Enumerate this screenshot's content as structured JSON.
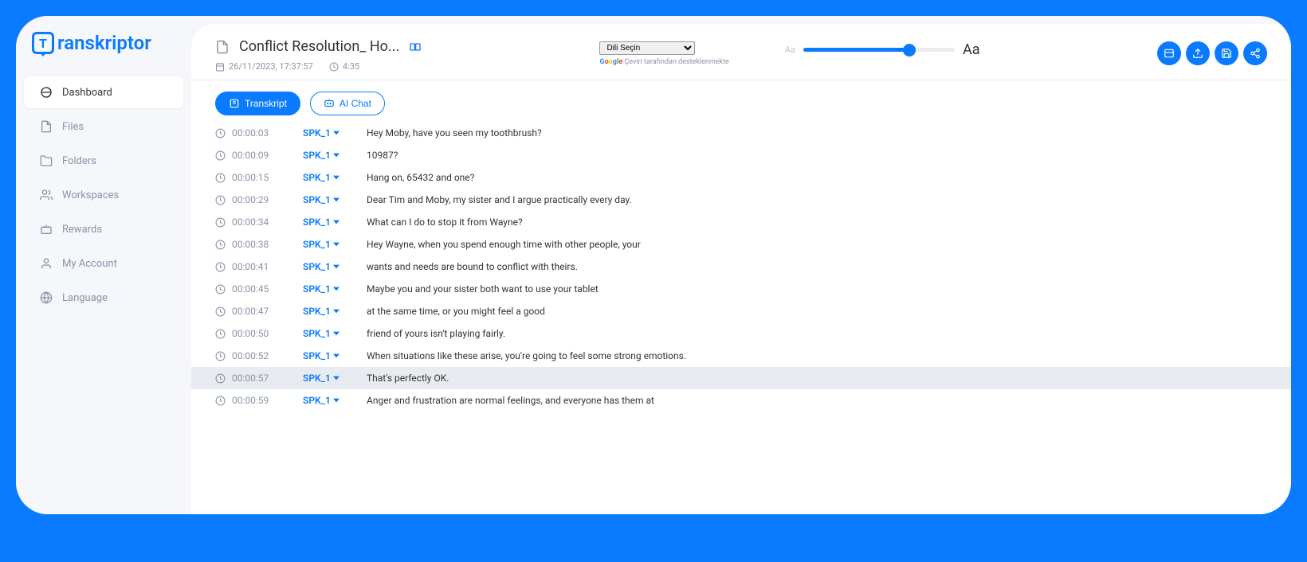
{
  "brand": "ranskriptor",
  "sidebar": {
    "items": [
      {
        "label": "Dashboard",
        "active": true
      },
      {
        "label": "Files",
        "active": false
      },
      {
        "label": "Folders",
        "active": false
      },
      {
        "label": "Workspaces",
        "active": false
      },
      {
        "label": "Rewards",
        "active": false
      },
      {
        "label": "My Account",
        "active": false
      },
      {
        "label": "Language",
        "active": false
      }
    ]
  },
  "header": {
    "title": "Conflict Resolution_ Ho...",
    "date": "26/11/2023, 17:37:57",
    "duration": "4:35",
    "lang_select": "Dili Seçin",
    "lang_note": "Çeviri tarafından desteklenmekte",
    "font_small": "Aa",
    "font_large": "Aa"
  },
  "tabs": {
    "transkript": "Transkript",
    "aichat": "AI Chat"
  },
  "transcript": [
    {
      "time": "00:00:03",
      "speaker": "SPK_1",
      "text": "Hey Moby, have you seen my toothbrush?",
      "hl": false
    },
    {
      "time": "00:00:09",
      "speaker": "SPK_1",
      "text": "10987?",
      "hl": false
    },
    {
      "time": "00:00:15",
      "speaker": "SPK_1",
      "text": "Hang on, 65432 and one?",
      "hl": false
    },
    {
      "time": "00:00:29",
      "speaker": "SPK_1",
      "text": "Dear Tim and Moby, my sister and I argue practically every day.",
      "hl": false
    },
    {
      "time": "00:00:34",
      "speaker": "SPK_1",
      "text": "What can I do to stop it from Wayne?",
      "hl": false
    },
    {
      "time": "00:00:38",
      "speaker": "SPK_1",
      "text": "Hey Wayne, when you spend enough time with other people, your",
      "hl": false
    },
    {
      "time": "00:00:41",
      "speaker": "SPK_1",
      "text": "wants and needs are bound to conflict with theirs.",
      "hl": false
    },
    {
      "time": "00:00:45",
      "speaker": "SPK_1",
      "text": "Maybe you and your sister both want to use your tablet",
      "hl": false
    },
    {
      "time": "00:00:47",
      "speaker": "SPK_1",
      "text": "at the same time, or you might feel a good",
      "hl": false
    },
    {
      "time": "00:00:50",
      "speaker": "SPK_1",
      "text": "friend of yours isn't playing fairly.",
      "hl": false
    },
    {
      "time": "00:00:52",
      "speaker": "SPK_1",
      "text": "When situations like these arise, you're going to feel some strong emotions.",
      "hl": false
    },
    {
      "time": "00:00:57",
      "speaker": "SPK_1",
      "text": "That's perfectly OK.",
      "hl": true
    },
    {
      "time": "00:00:59",
      "speaker": "SPK_1",
      "text": "Anger and frustration are normal feelings, and everyone has them at",
      "hl": false
    }
  ]
}
